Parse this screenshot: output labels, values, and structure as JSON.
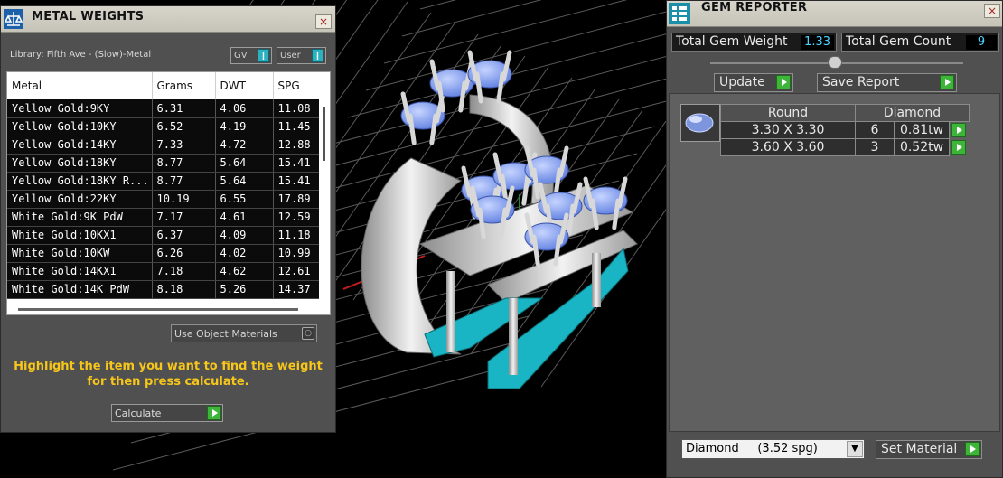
{
  "metal_weights": {
    "title": "METAL WEIGHTS",
    "close": "×",
    "library": "Library: Fifth Ave - (Slow)-Metal",
    "toggle_gv": "GV",
    "toggle_user": "User",
    "toggle_glyph": "❙",
    "columns": [
      "Metal",
      "Grams",
      "DWT",
      "SPG"
    ],
    "rows": [
      [
        "Yellow Gold:9KY",
        "6.31",
        "4.06",
        "11.08"
      ],
      [
        "Yellow Gold:10KY",
        "6.52",
        "4.19",
        "11.45"
      ],
      [
        "Yellow Gold:14KY",
        "7.33",
        "4.72",
        "12.88"
      ],
      [
        "Yellow Gold:18KY",
        "8.77",
        "5.64",
        "15.41"
      ],
      [
        "Yellow Gold:18KY R...",
        "8.77",
        "5.64",
        "15.41"
      ],
      [
        "Yellow Gold:22KY",
        "10.19",
        "6.55",
        "17.89"
      ],
      [
        "White Gold:9K PdW",
        "7.17",
        "4.61",
        "12.59"
      ],
      [
        "White Gold:10KX1",
        "6.37",
        "4.09",
        "11.18"
      ],
      [
        "White Gold:10KW",
        "6.26",
        "4.02",
        "10.99"
      ],
      [
        "White Gold:14KX1",
        "7.18",
        "4.62",
        "12.61"
      ],
      [
        "White Gold:14K PdW",
        "8.18",
        "5.26",
        "14.37"
      ]
    ],
    "use_object_materials": "Use Object Materials",
    "radio_glyph": "○",
    "hint_line1": "Highlight the item you want to find the weight",
    "hint_line2": "for then press calculate.",
    "calculate": "Calculate"
  },
  "gem_reporter": {
    "title": "GEM REPORTER",
    "close": "×",
    "total_weight_label": "Total Gem Weight",
    "total_weight_value": "1.33",
    "total_count_label": "Total Gem Count",
    "total_count_value": "9",
    "update": "Update",
    "save_report": "Save Report",
    "shape": "Round",
    "material": "Diamond",
    "gems": [
      {
        "size": "3.30 X 3.30",
        "count": "6",
        "weight": "0.81tw"
      },
      {
        "size": "3.60 X 3.60",
        "count": "3",
        "weight": "0.52tw"
      }
    ],
    "material_select": "Diamond     (3.52 spg)",
    "dropdown_glyph": "▼",
    "set_material": "Set Material"
  },
  "colors": {
    "hint": "#f6c61a",
    "counter": "#4fd2ff",
    "go": "#3fb43a",
    "support": "#19b5c4",
    "gem": "#7d9cf0"
  }
}
